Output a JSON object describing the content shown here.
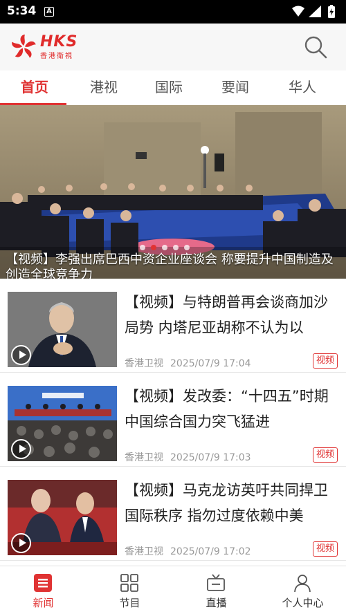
{
  "status_bar": {
    "time": "5:34",
    "notification_icon": "a-icon",
    "icons": [
      "wifi-icon",
      "signal-icon",
      "battery-icon"
    ]
  },
  "header": {
    "logo_text": "HKS",
    "logo_subtext": "香港衛視",
    "search_icon": "search-icon"
  },
  "tabs": [
    {
      "label": "首页",
      "active": true
    },
    {
      "label": "港视",
      "active": false
    },
    {
      "label": "国际",
      "active": false
    },
    {
      "label": "要闻",
      "active": false
    },
    {
      "label": "华人",
      "active": false
    }
  ],
  "banner": {
    "title": "【视频】李强出席巴西中资企业座谈会 称要提升中国制造及创造全球竞争力",
    "dot_count": 5,
    "active_dot": 1
  },
  "news": [
    {
      "title": "【视频】与特朗普再会谈商加沙局势 内塔尼亚胡称不认为以",
      "source": "香港卫视",
      "datetime": "2025/07/9 17:04",
      "tag": "视频"
    },
    {
      "title": "【视频】发改委：“十四五”时期中国综合国力突飞猛进",
      "source": "香港卫视",
      "datetime": "2025/07/9 17:03",
      "tag": "视频"
    },
    {
      "title": "【视频】马克龙访英吁共同捍卫国际秩序 指勿过度依赖中美",
      "source": "香港卫视",
      "datetime": "2025/07/9 17:02",
      "tag": "视频"
    }
  ],
  "bottom_nav": [
    {
      "label": "新闻",
      "icon": "news-icon",
      "active": true
    },
    {
      "label": "节目",
      "icon": "grid-icon",
      "active": false
    },
    {
      "label": "直播",
      "icon": "tv-icon",
      "active": false
    },
    {
      "label": "个人中心",
      "icon": "user-icon",
      "active": false
    }
  ],
  "colors": {
    "accent": "#e03333",
    "text": "#222222",
    "meta": "#999999"
  }
}
